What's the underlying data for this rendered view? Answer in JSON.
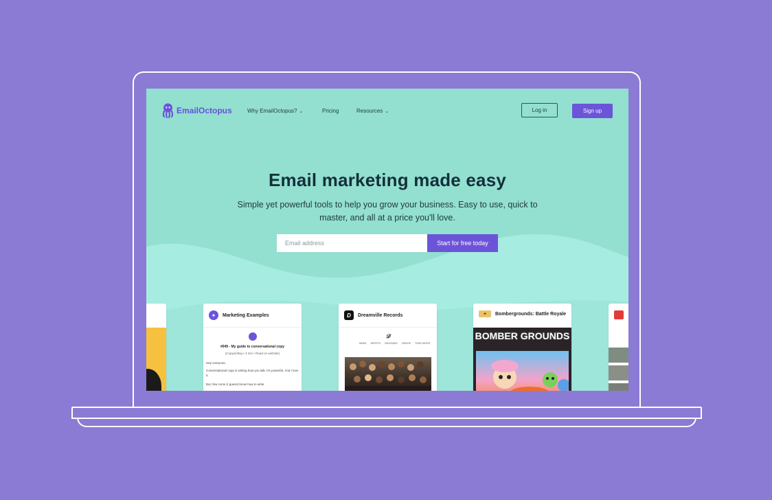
{
  "brand": {
    "name": "EmailOctopus",
    "color": "#6c54d9"
  },
  "nav": {
    "links": [
      {
        "label": "Why EmailOctopus?",
        "has_dropdown": true
      },
      {
        "label": "Pricing",
        "has_dropdown": false
      },
      {
        "label": "Resources",
        "has_dropdown": true
      }
    ],
    "login_label": "Log in",
    "signup_label": "Sign up"
  },
  "hero": {
    "title": "Email marketing made easy",
    "subtitle": "Simple yet powerful tools to help you grow your business. Easy to use, quick to master, and all at a price you'll love.",
    "email_placeholder": "Email address",
    "cta_label": "Start for free today"
  },
  "cards": [
    {
      "title": "Marketing Examples",
      "icon": "lightbulb-icon",
      "heading": "#049 - My guide to conversational copy",
      "meta": "(Copywriting • 3 min • Read on website)",
      "body": [
        "Hey everyone,",
        "Conversational copy is writing how you talk. It's powerful. And I love it.",
        "But, few come (I guess) know how to write."
      ]
    },
    {
      "title": "Dreamville Records",
      "icon": "dreamville-icon",
      "menu": [
        "NEWS",
        "ARTISTS",
        "RELEASES",
        "VIDEOS",
        "TOUR DATES"
      ]
    },
    {
      "title": "Bombergrounds: Battle Royale",
      "icon": "bombergrounds-icon",
      "logo_text": "BOMBER GROUNDS"
    }
  ],
  "colors": {
    "background": "#8b7bd4",
    "hero_bg": "#93dfd0",
    "wave_light": "#a7ece0",
    "accent": "#6c54d9"
  }
}
